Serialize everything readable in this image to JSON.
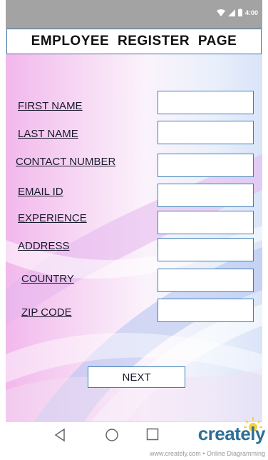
{
  "status_bar": {
    "time": "4:00"
  },
  "header": {
    "title": "EMPLOYEE  REGISTER  PAGE"
  },
  "form": {
    "fields": [
      {
        "label": "FIRST NAME",
        "value": ""
      },
      {
        "label": "LAST NAME",
        "value": ""
      },
      {
        "label": "CONTACT NUMBER",
        "value": ""
      },
      {
        "label": "EMAIL ID",
        "value": ""
      },
      {
        "label": "EXPERIENCE",
        "value": ""
      },
      {
        "label": "ADDRESS",
        "value": ""
      },
      {
        "label": "COUNTRY",
        "value": ""
      },
      {
        "label": "ZIP CODE",
        "value": ""
      }
    ],
    "next_label": "NEXT"
  },
  "nav_bar": {
    "icons": [
      "back-icon",
      "home-icon",
      "recent-apps-icon"
    ]
  },
  "watermark": {
    "brand": "creately",
    "tagline": "www.creately.com • Online Diagramming"
  },
  "colors": {
    "accent": "#3d7fb8",
    "status_bar": "#a3a3a3",
    "brand": "#2e6f99",
    "brand_highlight": "#8ac540"
  }
}
